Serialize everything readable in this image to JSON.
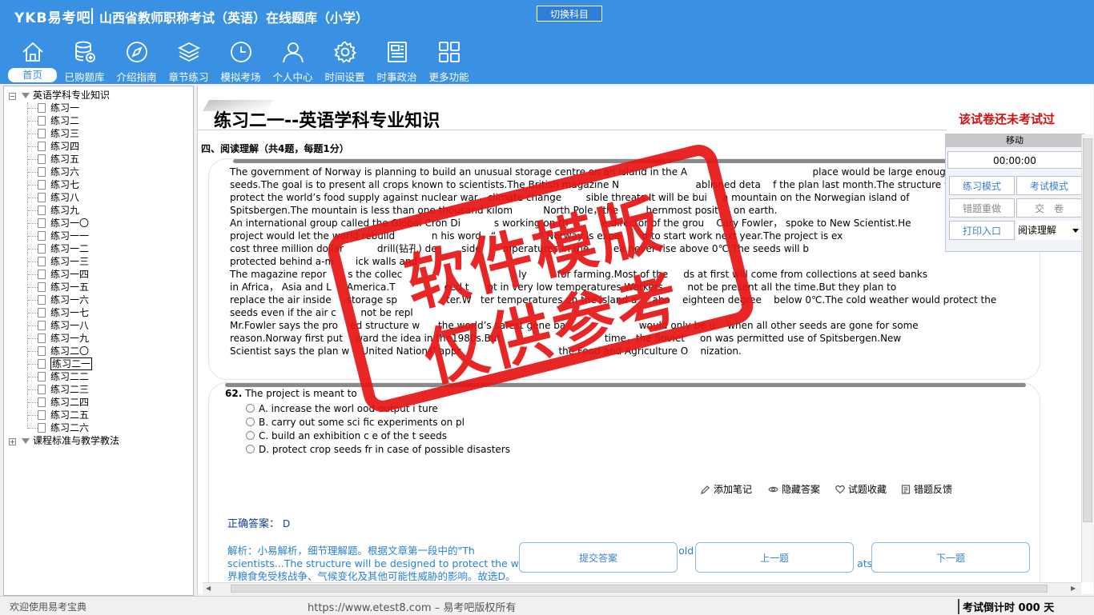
{
  "header": {
    "brand": "YKB易考吧",
    "title": "山西省教师职称考试（英语）在线题库（小学）",
    "switch_label": "切换科目",
    "nav": [
      {
        "label": "首页",
        "icon": "home-icon"
      },
      {
        "label": "已购题库",
        "icon": "database-icon"
      },
      {
        "label": "介绍指南",
        "icon": "compass-icon"
      },
      {
        "label": "章节练习",
        "icon": "layers-icon"
      },
      {
        "label": "模拟考场",
        "icon": "clock-icon"
      },
      {
        "label": "个人中心",
        "icon": "user-icon"
      },
      {
        "label": "时间设置",
        "icon": "gear-icon"
      },
      {
        "label": "时事政治",
        "icon": "news-icon"
      },
      {
        "label": "更多功能",
        "icon": "grid-icon"
      }
    ]
  },
  "tree": {
    "root": "英语学科专业知识",
    "items": [
      "练习一",
      "练习二",
      "练习三",
      "练习四",
      "练习五",
      "练习六",
      "练习七",
      "练习八",
      "练习九",
      "练习一〇",
      "练习一一",
      "练习一二",
      "练习一三",
      "练习一四",
      "练习一五",
      "练习一六",
      "练习一七",
      "练习一八",
      "练习一九",
      "练习二〇",
      "练习二一",
      "练习二二",
      "练习二三",
      "练习二四",
      "练习二五",
      "练习二六"
    ],
    "selected": "练习二一",
    "root2": "课程标准与教学教法"
  },
  "main": {
    "exam_title": "练习二一--英语学科专业知识",
    "not_taken": "该试卷还未考试过",
    "section": "四、阅读理解（共4题，每题1分）",
    "passage": [
      "The government of Norway is planning to build an unusual storage centre on an island in the A                                         place would be large enough to hold about tw",
      "seeds.The goal is to present all crops known to scientists.The British magazine N                         ablisned deta    f the plan last month.The structure will be d",
      "protect the world’s food supply against nuclear war，climate change        sible threats.It will be bui     a mountain on the Norwegian island of",
      "Spitsbergen.The mountain is less than one thousand kilom          North Pole，the         hernmost posit     on earth.",
      "An international group called the Global Cron Di           s working on th           e director of the grou    Cary Fowler， spoke to New Scientist.He",
      "project would let the world rebuild            n his word，“              ” Norway is expe       d to start work next year.The project is ex",
      "cost three million dollar           drill(钻孔) de        side       mperatures in the        ea never rise above 0℃.The seeds will b",
      "protected behind a-m       ick walls and          ",
      "The magazine repor       s the collec                                      ly          for farming.Most of the     ds at first will come from collections at seed banks",
      "in Africa， Asia and L     America.T                eed t      pt in very low temperatures.Workers        not be present all the time.But they plan to",
      "replace the air inside     storage sp                ter.W   ter temperatures on the island a     abo    eighteen degree    below 0℃.The cold weather would protect the",
      "seeds even if the air c        not be repl",
      "Mr.Fowler says the pro    ed structure w      the world’s safest gene ba                        would only be u    when all other seeds are gone for some",
      "reason.Norway first put    ward the idea in the1980s.But                                  time，the Soviet     on was permitted use of Spitsbergen.New",
      "Scientist says the plan w    United Nations’ appr                                the Food and Agriculture O    nization."
    ],
    "question_num": "62.",
    "question_text": "The project is meant to",
    "options": [
      "A. increase the worl      ood output i       ture",
      "B. carry out some sci       fic experiments on pl",
      "C. build an exhibition c      e of the             t seeds",
      "D. protect crop seeds fr                   in case of possible disasters"
    ],
    "tools": [
      "添加笔记",
      "隐藏答案",
      "试题收藏",
      "错题反馈"
    ],
    "answer_label": "正确答案：",
    "answer_value": "D",
    "analysis": [
      "解析：小易解析，细节理解题。根据文章第一段中的\"Th                                                              hold                                   s to",
      "scientists...The structure will be designed to protect the world’s                                                        clim                                   ats.",
      "界粮食免受核战争、气候变化及其他可能性威胁的影响。故选D。"
    ],
    "buttons": {
      "submit": "提交答案",
      "prev": "上一题",
      "next": "下一题"
    }
  },
  "panel": {
    "move": "移动",
    "timer": "00:00:00",
    "practice_mode": "练习模式",
    "exam_mode": "考试模式",
    "redo_wrong": "错题重做",
    "submit_paper": "交　卷",
    "print": "打印入口",
    "select_value": "阅读理解"
  },
  "status": {
    "left": "欢迎使用易考宝典",
    "mid": "https://www.etest8.com – 易考吧版权所有",
    "right": "考试倒计时 000 天"
  },
  "watermark": {
    "line1": "软件模版",
    "line2": "仅供参考"
  }
}
